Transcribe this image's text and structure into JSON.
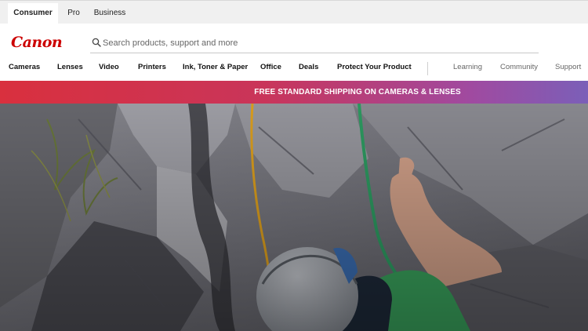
{
  "segments": {
    "consumer": "Consumer",
    "pro": "Pro",
    "business": "Business"
  },
  "brand": {
    "logo_text": "Canon",
    "color": "#cc0000"
  },
  "search": {
    "placeholder": "Search products, support and more",
    "icon": "search-icon"
  },
  "nav": {
    "primary": [
      "Cameras",
      "Lenses",
      "Video",
      "Printers",
      "Ink, Toner & Paper",
      "Office",
      "Deals",
      "Protect Your Product"
    ],
    "secondary": [
      "Learning",
      "Community",
      "Support"
    ]
  },
  "promo": {
    "text": "FREE STANDARD SHIPPING ON CAMERAS & LENSES",
    "gradient_start": "#d9303e",
    "gradient_end": "#7b5fb8"
  }
}
